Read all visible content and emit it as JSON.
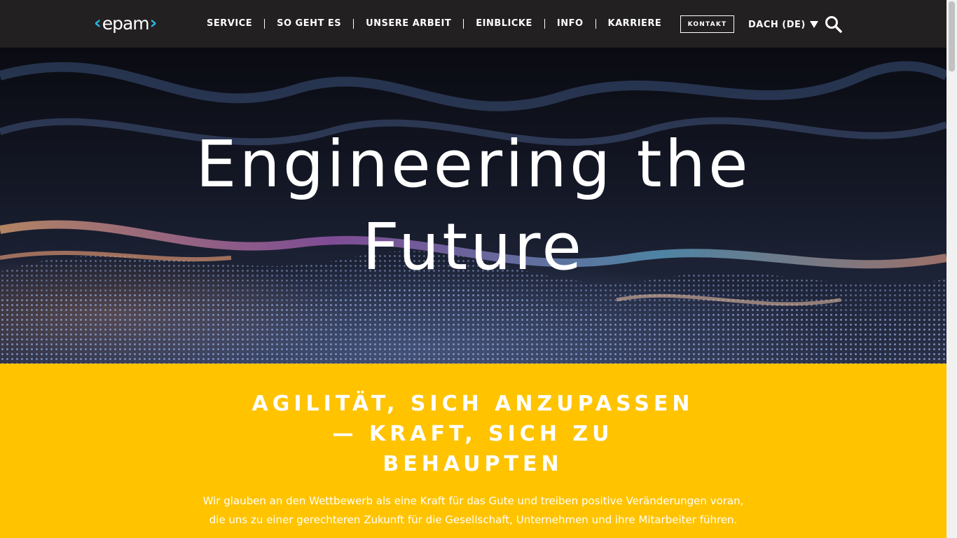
{
  "header": {
    "logo_text": "epam",
    "nav": [
      {
        "label": "SERVICE"
      },
      {
        "label": "SO GEHT ES"
      },
      {
        "label": "UNSERE ARBEIT"
      },
      {
        "label": "EINBLICKE"
      },
      {
        "label": "INFO"
      },
      {
        "label": "KARRIERE"
      }
    ],
    "contact_label": "KONTAKT",
    "region_label": "DACH (DE)",
    "search_icon": "search-icon"
  },
  "hero": {
    "title_line1": "Engineering the",
    "title_line2": "Future"
  },
  "intro": {
    "heading_line1": "AGILITÄT, SICH ANZUPASSEN",
    "heading_line2": "— KRAFT, SICH ZU",
    "heading_line3": "BEHAUPTEN",
    "text_line1": "Wir glauben an den Wettbewerb als eine Kraft für das Gute und treiben positive Veränderungen voran,",
    "text_line2": "die uns zu einer gerechteren Zukunft für die Gesellschaft, Unternehmen und ihre Mitarbeiter führen."
  },
  "colors": {
    "header_bg": "#222021",
    "logo_accent": "#2db4e6",
    "band_bg": "#ffc300"
  }
}
